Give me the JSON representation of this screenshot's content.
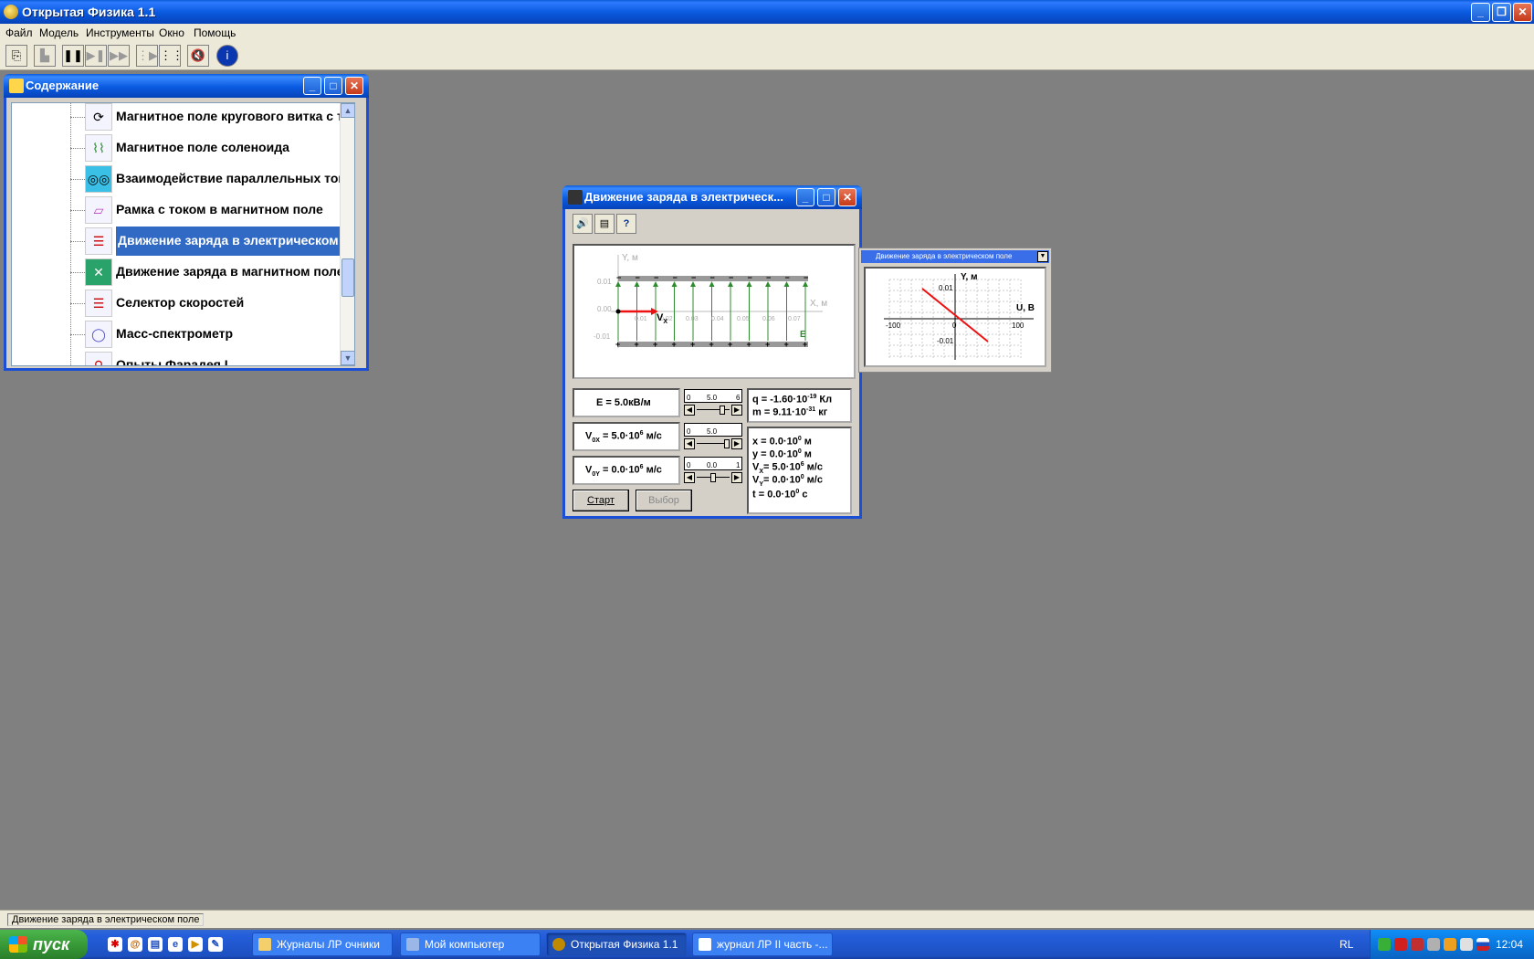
{
  "app": {
    "title": "Открытая Физика 1.1"
  },
  "menu": [
    "Файл",
    "Модель",
    "Инструменты",
    "Окно",
    "Помощь"
  ],
  "contents": {
    "title": "Содержание",
    "items": [
      {
        "label": "Магнитное поле кругового витка с током",
        "icon": "coil-icon"
      },
      {
        "label": "Магнитное поле соленоида",
        "icon": "solenoid-icon"
      },
      {
        "label": "Взаимодействие параллельных токов",
        "icon": "currents-icon"
      },
      {
        "label": "Рамка с током в магнитном поле",
        "icon": "frame-icon"
      },
      {
        "label": "Движение заряда в электрическом поле",
        "icon": "capacitor-icon",
        "selected": true
      },
      {
        "label": "Движение заряда в магнитном поле",
        "icon": "magnet-icon"
      },
      {
        "label": "Селектор скоростей",
        "icon": "selector-icon"
      },
      {
        "label": "Масс-спектрометр",
        "icon": "spectrometer-icon"
      },
      {
        "label": "Опыты Фарадея I",
        "icon": "faraday-icon"
      }
    ]
  },
  "sim": {
    "title": "Движение заряда в электрическ...",
    "plot": {
      "y_axis": "Y, м",
      "x_axis": "X, м",
      "y_ticks": [
        "0.01",
        "0.00",
        "-0.01"
      ],
      "x_ticks": [
        "0.01",
        "0.02",
        "0.03",
        "0.04",
        "0.05",
        "0.06",
        "0.07"
      ],
      "velocity_label": "V",
      "velocity_sub": "X",
      "field_label": "E"
    },
    "params": {
      "E": "E = 5.0кВ/м",
      "vox": "V",
      "vox_sub": "0X",
      "vox_val": "= 5.0·10",
      "vox_exp": "6",
      "vox_unit": " м/с",
      "voy": "V",
      "voy_sub": "0Y",
      "voy_val": "= 0.0·10",
      "voy_exp": "6",
      "voy_unit": " м/с"
    },
    "sliders": [
      {
        "min": "0",
        "mid": "5.0",
        "max": "6",
        "fraction": 0.83
      },
      {
        "min": "0",
        "mid": "5.0",
        "max": "",
        "fraction": 1.0
      },
      {
        "min": "0",
        "mid": "0.0",
        "max": "1",
        "fraction": 0.5
      }
    ],
    "constants": {
      "q": "q = -1.60·10",
      "q_exp": "-19",
      "q_unit": " Кл",
      "m": "m = 9.11·10",
      "m_exp": "-31",
      "m_unit": " кг"
    },
    "readout": [
      {
        "pre": "x = 0.0·10",
        "exp": "0",
        "unit": " м"
      },
      {
        "pre": "y = 0.0·10",
        "exp": "0",
        "unit": " м"
      },
      {
        "pre": "V",
        "sub": "X",
        "mid": "= 5.0·10",
        "exp": "6",
        "unit": " м/с"
      },
      {
        "pre": "V",
        "sub": "Y",
        "mid": "= 0.0·10",
        "exp": "0",
        "unit": " м/с"
      },
      {
        "pre": "t = 0.0·10",
        "exp": "0",
        "unit": " с"
      }
    ],
    "buttons": {
      "start": "Старт",
      "select": "Выбор"
    }
  },
  "graph": {
    "title": "Движение заряда в электрическом поле",
    "y_axis": "Y, м",
    "x_axis": "U, В",
    "y_ticks": [
      "0.01",
      "-0.01"
    ],
    "x_ticks": [
      "-100",
      "0",
      "100"
    ],
    "line_color": "#ee1111"
  },
  "status": "Движение заряда в электрическом поле",
  "taskbar": {
    "start": "пуск",
    "tasks": [
      {
        "label": "Журналы ЛР очники"
      },
      {
        "label": "Мой компьютер"
      },
      {
        "label": "Открытая Физика 1.1",
        "active": true
      },
      {
        "label": "журнал ЛР II часть -..."
      }
    ],
    "lang": "RL",
    "clock": "12:04"
  },
  "colors": {
    "accent": "#0b5be1",
    "selection": "#316ac5",
    "field_lines": "#2e8b2e",
    "velocity": "#ee1111"
  }
}
